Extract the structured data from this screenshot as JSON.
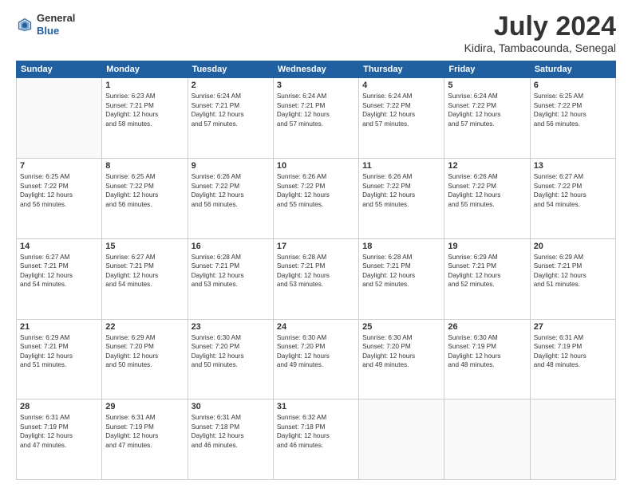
{
  "header": {
    "logo_general": "General",
    "logo_blue": "Blue",
    "month_title": "July 2024",
    "location": "Kidira, Tambacounda, Senegal"
  },
  "weekdays": [
    "Sunday",
    "Monday",
    "Tuesday",
    "Wednesday",
    "Thursday",
    "Friday",
    "Saturday"
  ],
  "weeks": [
    [
      {
        "day": "",
        "info": ""
      },
      {
        "day": "1",
        "info": "Sunrise: 6:23 AM\nSunset: 7:21 PM\nDaylight: 12 hours\nand 58 minutes."
      },
      {
        "day": "2",
        "info": "Sunrise: 6:24 AM\nSunset: 7:21 PM\nDaylight: 12 hours\nand 57 minutes."
      },
      {
        "day": "3",
        "info": "Sunrise: 6:24 AM\nSunset: 7:21 PM\nDaylight: 12 hours\nand 57 minutes."
      },
      {
        "day": "4",
        "info": "Sunrise: 6:24 AM\nSunset: 7:22 PM\nDaylight: 12 hours\nand 57 minutes."
      },
      {
        "day": "5",
        "info": "Sunrise: 6:24 AM\nSunset: 7:22 PM\nDaylight: 12 hours\nand 57 minutes."
      },
      {
        "day": "6",
        "info": "Sunrise: 6:25 AM\nSunset: 7:22 PM\nDaylight: 12 hours\nand 56 minutes."
      }
    ],
    [
      {
        "day": "7",
        "info": "Sunrise: 6:25 AM\nSunset: 7:22 PM\nDaylight: 12 hours\nand 56 minutes."
      },
      {
        "day": "8",
        "info": "Sunrise: 6:25 AM\nSunset: 7:22 PM\nDaylight: 12 hours\nand 56 minutes."
      },
      {
        "day": "9",
        "info": "Sunrise: 6:26 AM\nSunset: 7:22 PM\nDaylight: 12 hours\nand 56 minutes."
      },
      {
        "day": "10",
        "info": "Sunrise: 6:26 AM\nSunset: 7:22 PM\nDaylight: 12 hours\nand 55 minutes."
      },
      {
        "day": "11",
        "info": "Sunrise: 6:26 AM\nSunset: 7:22 PM\nDaylight: 12 hours\nand 55 minutes."
      },
      {
        "day": "12",
        "info": "Sunrise: 6:26 AM\nSunset: 7:22 PM\nDaylight: 12 hours\nand 55 minutes."
      },
      {
        "day": "13",
        "info": "Sunrise: 6:27 AM\nSunset: 7:22 PM\nDaylight: 12 hours\nand 54 minutes."
      }
    ],
    [
      {
        "day": "14",
        "info": "Sunrise: 6:27 AM\nSunset: 7:21 PM\nDaylight: 12 hours\nand 54 minutes."
      },
      {
        "day": "15",
        "info": "Sunrise: 6:27 AM\nSunset: 7:21 PM\nDaylight: 12 hours\nand 54 minutes."
      },
      {
        "day": "16",
        "info": "Sunrise: 6:28 AM\nSunset: 7:21 PM\nDaylight: 12 hours\nand 53 minutes."
      },
      {
        "day": "17",
        "info": "Sunrise: 6:28 AM\nSunset: 7:21 PM\nDaylight: 12 hours\nand 53 minutes."
      },
      {
        "day": "18",
        "info": "Sunrise: 6:28 AM\nSunset: 7:21 PM\nDaylight: 12 hours\nand 52 minutes."
      },
      {
        "day": "19",
        "info": "Sunrise: 6:29 AM\nSunset: 7:21 PM\nDaylight: 12 hours\nand 52 minutes."
      },
      {
        "day": "20",
        "info": "Sunrise: 6:29 AM\nSunset: 7:21 PM\nDaylight: 12 hours\nand 51 minutes."
      }
    ],
    [
      {
        "day": "21",
        "info": "Sunrise: 6:29 AM\nSunset: 7:21 PM\nDaylight: 12 hours\nand 51 minutes."
      },
      {
        "day": "22",
        "info": "Sunrise: 6:29 AM\nSunset: 7:20 PM\nDaylight: 12 hours\nand 50 minutes."
      },
      {
        "day": "23",
        "info": "Sunrise: 6:30 AM\nSunset: 7:20 PM\nDaylight: 12 hours\nand 50 minutes."
      },
      {
        "day": "24",
        "info": "Sunrise: 6:30 AM\nSunset: 7:20 PM\nDaylight: 12 hours\nand 49 minutes."
      },
      {
        "day": "25",
        "info": "Sunrise: 6:30 AM\nSunset: 7:20 PM\nDaylight: 12 hours\nand 49 minutes."
      },
      {
        "day": "26",
        "info": "Sunrise: 6:30 AM\nSunset: 7:19 PM\nDaylight: 12 hours\nand 48 minutes."
      },
      {
        "day": "27",
        "info": "Sunrise: 6:31 AM\nSunset: 7:19 PM\nDaylight: 12 hours\nand 48 minutes."
      }
    ],
    [
      {
        "day": "28",
        "info": "Sunrise: 6:31 AM\nSunset: 7:19 PM\nDaylight: 12 hours\nand 47 minutes."
      },
      {
        "day": "29",
        "info": "Sunrise: 6:31 AM\nSunset: 7:19 PM\nDaylight: 12 hours\nand 47 minutes."
      },
      {
        "day": "30",
        "info": "Sunrise: 6:31 AM\nSunset: 7:18 PM\nDaylight: 12 hours\nand 46 minutes."
      },
      {
        "day": "31",
        "info": "Sunrise: 6:32 AM\nSunset: 7:18 PM\nDaylight: 12 hours\nand 46 minutes."
      },
      {
        "day": "",
        "info": ""
      },
      {
        "day": "",
        "info": ""
      },
      {
        "day": "",
        "info": ""
      }
    ]
  ]
}
